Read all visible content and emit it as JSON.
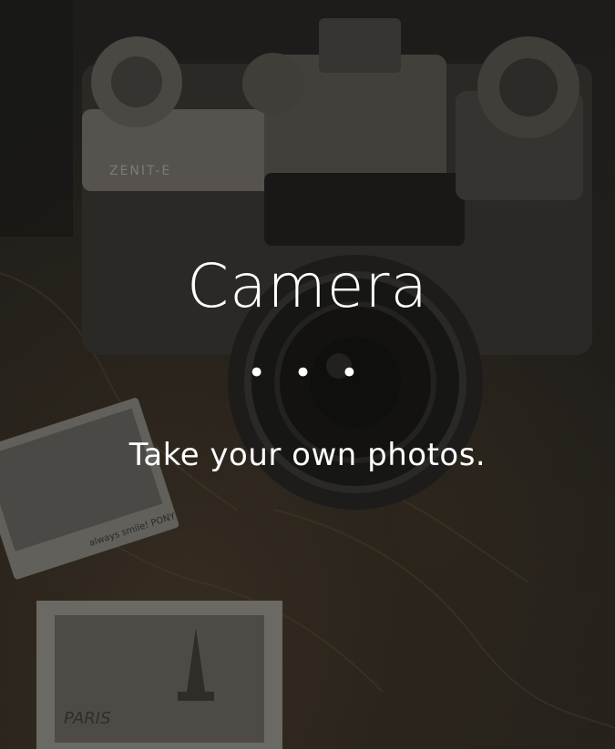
{
  "hero": {
    "title": "Camera",
    "separator": "• • •",
    "subtitle": "Take your own photos."
  },
  "background": {
    "camera_brand": "ZENIT-E",
    "postcard_text": "always smile! PONY BROWN",
    "polaroid_text": "PARIS",
    "icon": "vintage-camera-photo"
  }
}
